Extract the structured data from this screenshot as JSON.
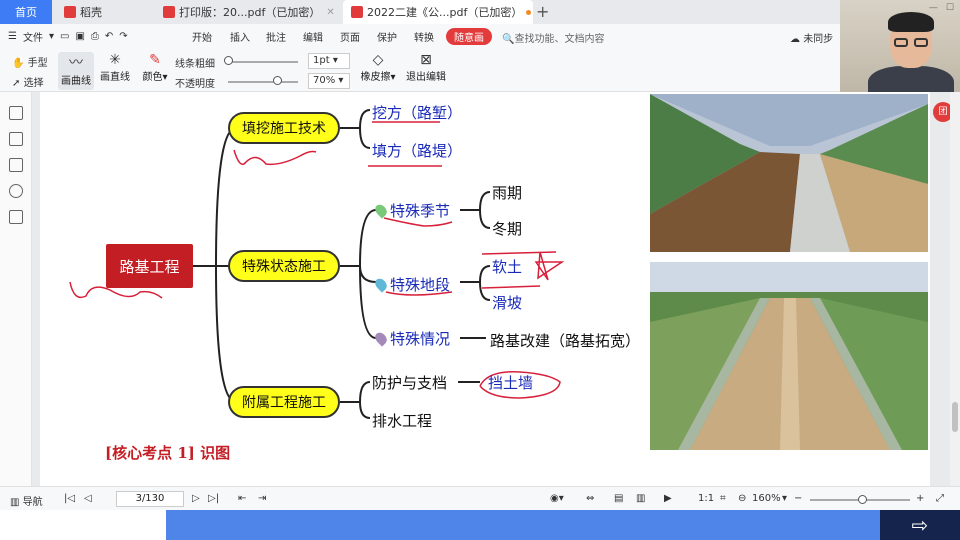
{
  "tabs": {
    "home": "首页",
    "tab1": "稻壳",
    "tab2": "打印版：20...pdf（已加密）",
    "tab3": "2022二建《公...pdf（已加密）",
    "new_tab": "+"
  },
  "menubar": {
    "file": "文件",
    "items": [
      "开始",
      "插入",
      "批注",
      "编辑",
      "页面",
      "保护",
      "转换",
      "随意画"
    ],
    "active": "随意画",
    "search_placeholder": "查找功能、文档内容",
    "sync": "未同步"
  },
  "toolbar": {
    "hand": "手型",
    "select": "选择",
    "curve": "画曲线",
    "line": "画直线",
    "color": "颜色",
    "line_width_label": "线条粗细",
    "line_width_value": "1pt",
    "opacity_label": "不透明度",
    "opacity_value": "70%",
    "opacity_level": 0.7,
    "eraser": "橡皮擦",
    "exit": "退出编辑"
  },
  "mindmap": {
    "root": "路基工程",
    "branches": [
      {
        "label": "填挖施工技术",
        "children": [
          "挖方（路堑）",
          "填方（路堤）"
        ]
      },
      {
        "label": "特殊状态施工",
        "children": [
          {
            "label": "特殊季节",
            "children": [
              "雨期",
              "冬期"
            ]
          },
          {
            "label": "特殊地段",
            "children": [
              "软土",
              "滑坡"
            ]
          },
          {
            "label": "特殊情况",
            "children": [
              "路基改建（路基拓宽）"
            ]
          }
        ]
      },
      {
        "label": "附属工程施工",
        "children": [
          "防护与支档",
          "挡土墙",
          "排水工程"
        ]
      }
    ],
    "callout": "[核心考点 1] 识图"
  },
  "badge": "团",
  "status": {
    "nav": "导航",
    "page": "3/130",
    "zoom": "160%"
  },
  "colors": {
    "accent": "#e33b3b",
    "root": "#c41e25",
    "node": "#ffff1a",
    "blue_text": "#1a2bb8",
    "taskbar": "#4f84e8"
  }
}
